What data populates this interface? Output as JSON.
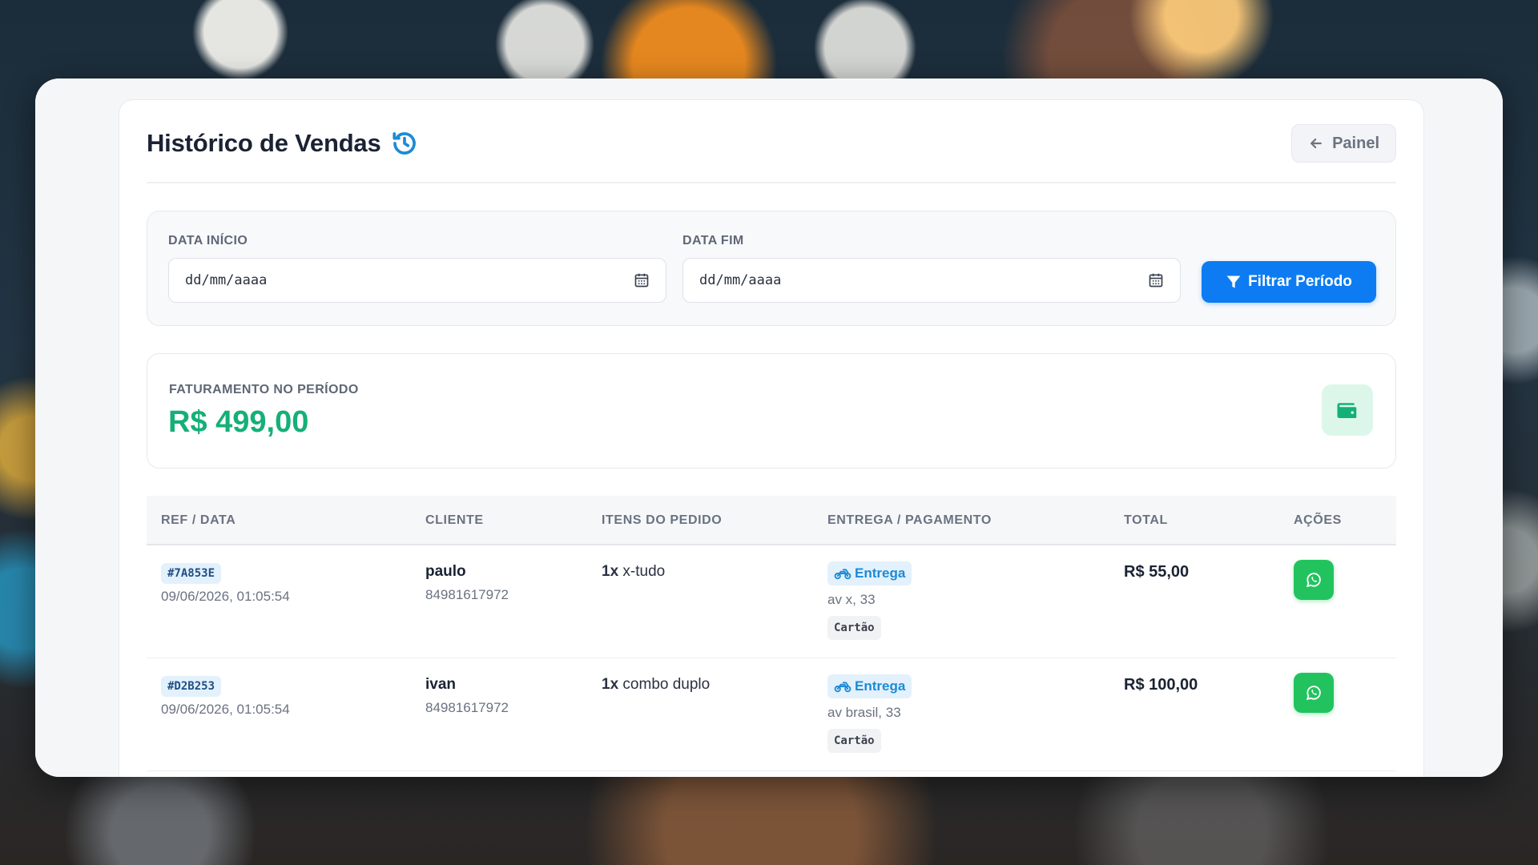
{
  "page": {
    "title": "Histórico de Vendas",
    "back_label": "Painel"
  },
  "filters": {
    "start_label": "DATA INÍCIO",
    "start_value": "dd/mm/aaaa",
    "end_label": "DATA FIM",
    "end_value": "dd/mm/aaaa",
    "button_label": "Filtrar Período"
  },
  "revenue": {
    "label": "FATURAMENTO NO PERÍODO",
    "value": "R$ 499,00"
  },
  "table": {
    "headers": [
      "REF / DATA",
      "CLIENTE",
      "ITENS DO PEDIDO",
      "ENTREGA / PAGAMENTO",
      "TOTAL",
      "AÇÕES"
    ],
    "rows": [
      {
        "ref": "#7A853E",
        "date": "09/06/2026, 01:05:54",
        "client": "paulo",
        "phone": "84981617972",
        "qty": "1x",
        "item": "x-tudo",
        "delivery": "Entrega",
        "address": "av x, 33",
        "payment": "Cartão",
        "total": "R$ 55,00"
      },
      {
        "ref": "#D2B253",
        "date": "09/06/2026, 01:05:54",
        "client": "ivan",
        "phone": "84981617972",
        "qty": "1x",
        "item": "combo duplo",
        "delivery": "Entrega",
        "address": "av brasil, 33",
        "payment": "Cartão",
        "total": "R$ 100,00"
      }
    ]
  },
  "colors": {
    "accent": "#0d7cf2",
    "revenue": "#15b077",
    "whatsapp": "#22c35e"
  },
  "icons": {
    "title": "history-icon",
    "back": "arrow-left-icon",
    "date": "calendar-icon",
    "filter": "funnel-icon",
    "revenue": "wallet-icon",
    "delivery": "motorcycle-icon",
    "action": "whatsapp-icon"
  }
}
